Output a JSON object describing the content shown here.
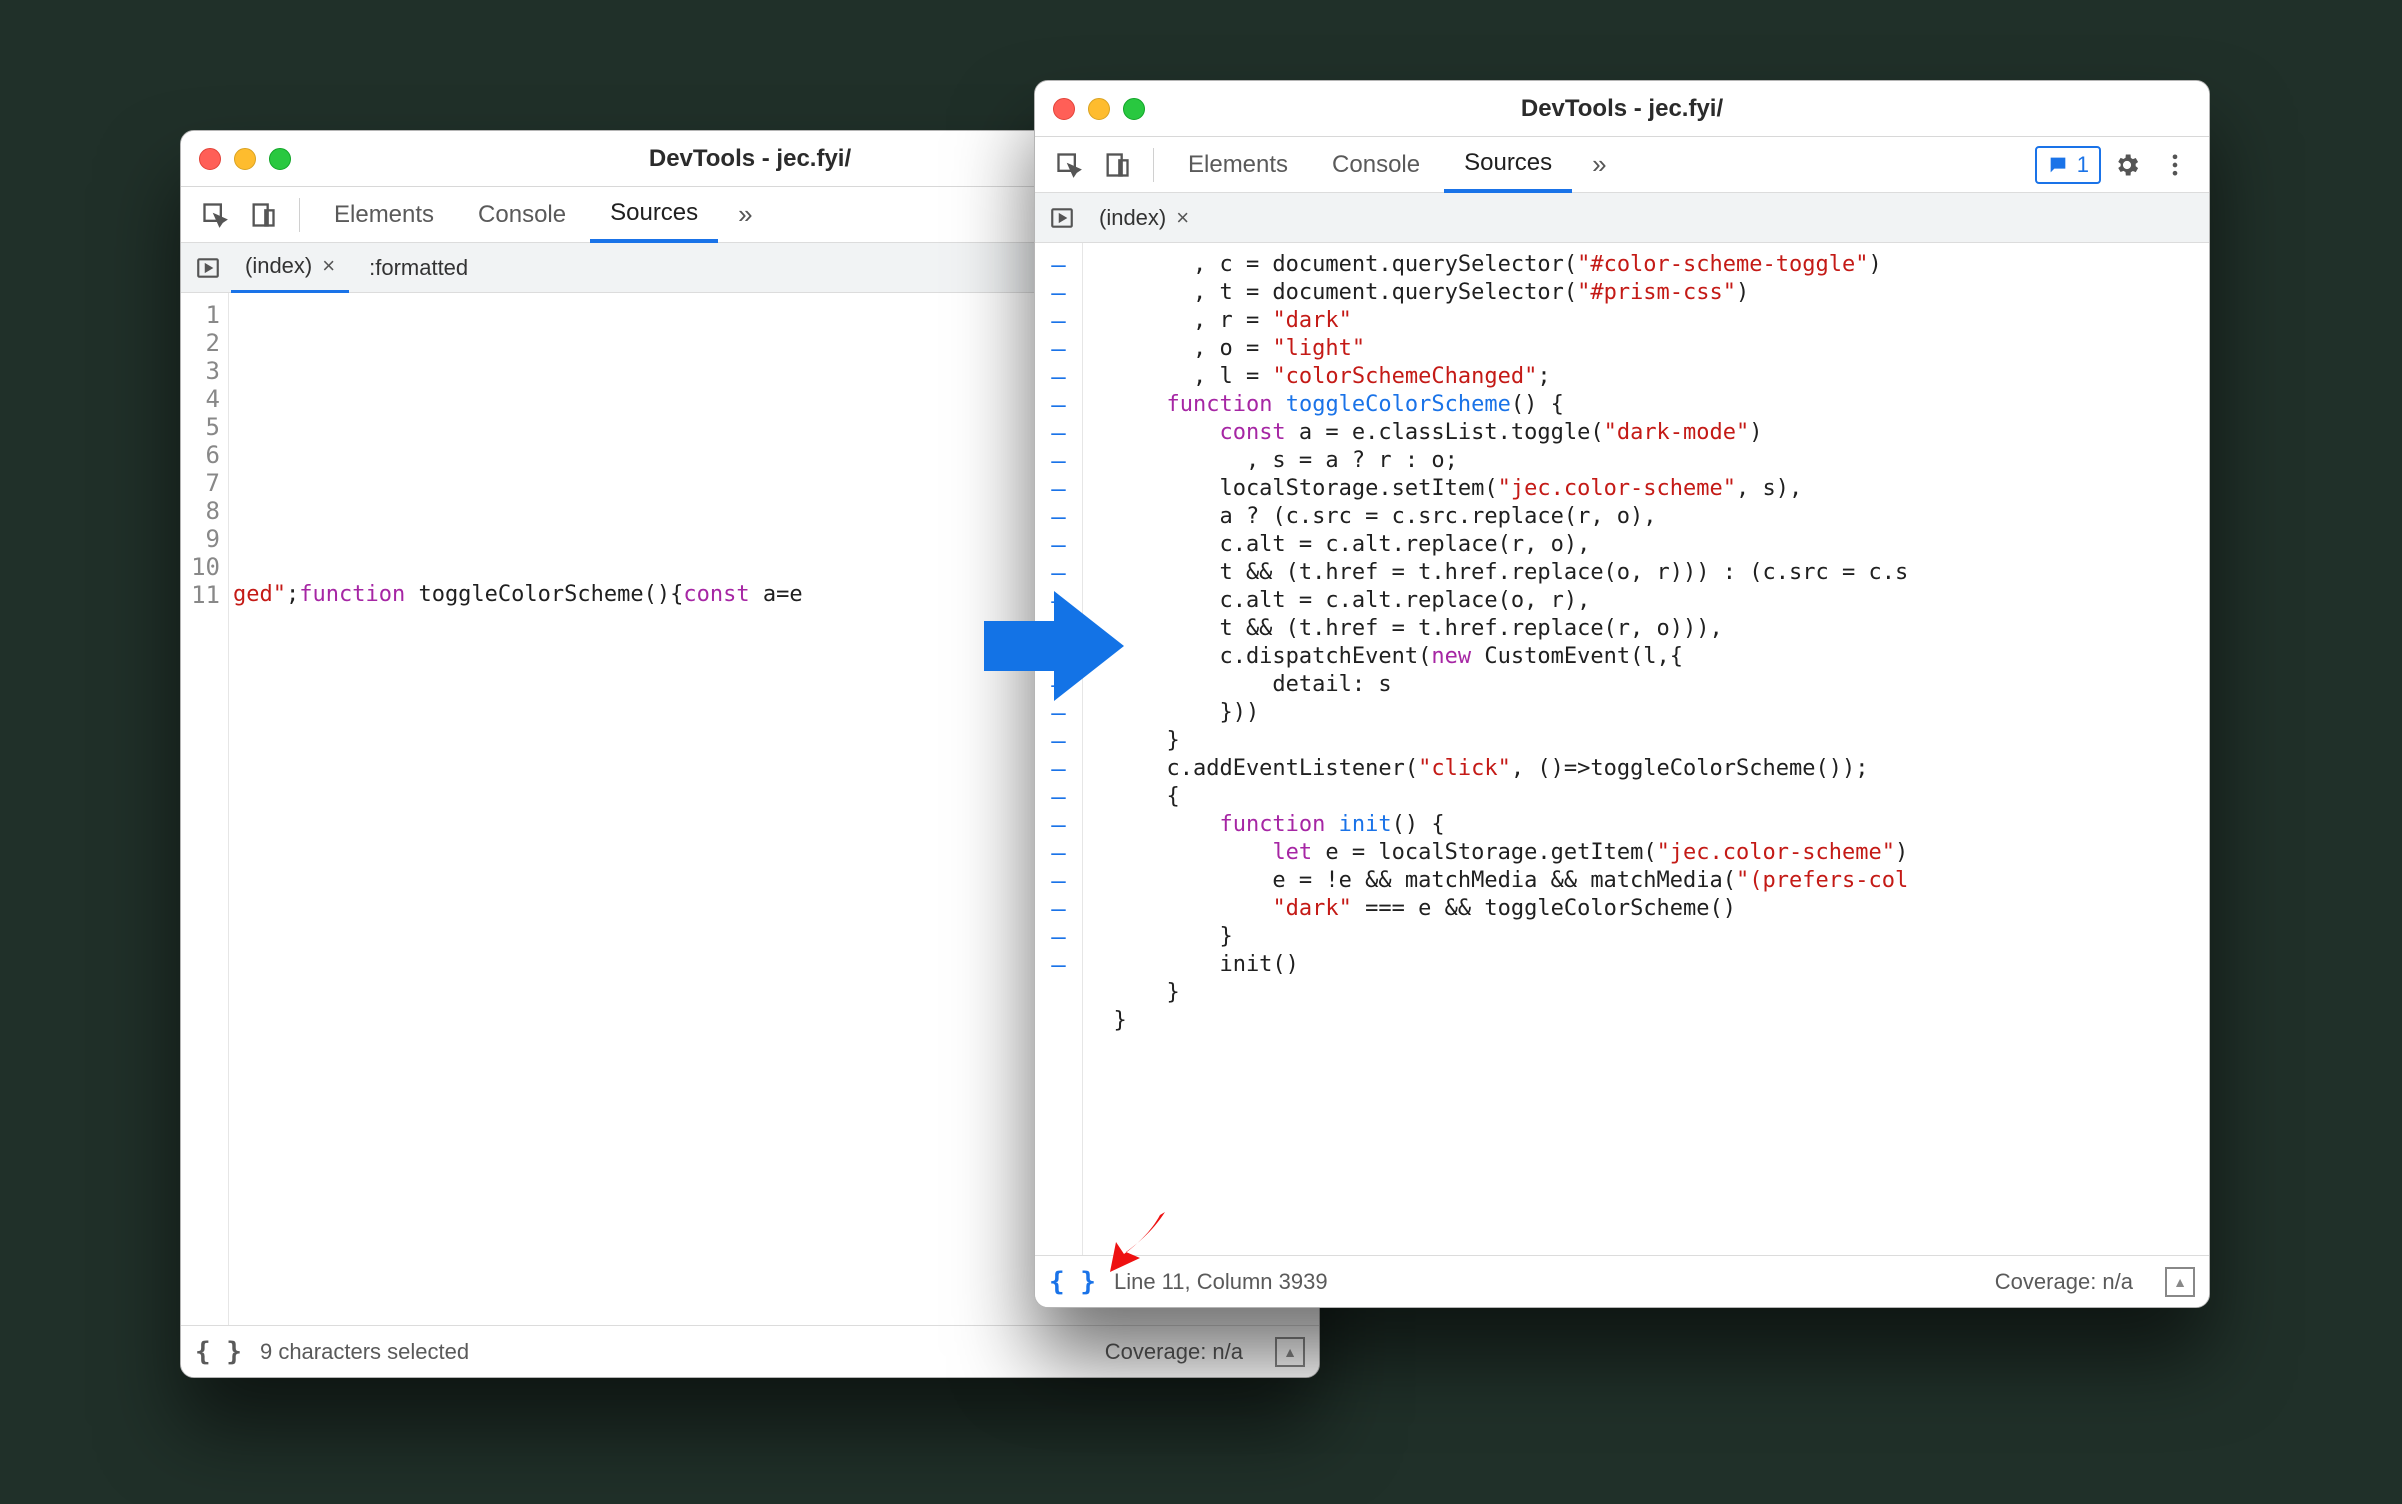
{
  "window_left": {
    "title": "DevTools - jec.fyi/",
    "tabs": {
      "elements": "Elements",
      "console": "Console",
      "sources": "Sources"
    },
    "file_tabs": {
      "index": "(index)",
      "formatted": ":formatted"
    },
    "line_numbers": [
      "1",
      "2",
      "3",
      "4",
      "5",
      "6",
      "7",
      "8",
      "9",
      "10",
      "11"
    ],
    "code_line11": {
      "seg1": "ged\"",
      "seg2": ";",
      "kw1": "function",
      "fn": " toggleColorScheme",
      "seg3": "(){",
      "kw2": "const",
      "seg4": " a=e"
    },
    "status_text": "9 characters selected",
    "coverage": "Coverage: n/a"
  },
  "window_right": {
    "title": "DevTools - jec.fyi/",
    "tabs": {
      "elements": "Elements",
      "console": "Console",
      "sources": "Sources"
    },
    "issues_count": "1",
    "file_tabs": {
      "index": "(index)"
    },
    "dash_count": 26,
    "code_lines": [
      {
        "indent": "        ",
        "tokens": [
          {
            "t": ", c = document.querySelector("
          },
          {
            "c": "str",
            "t": "\"#color-scheme-toggle\""
          },
          {
            "t": ")"
          }
        ]
      },
      {
        "indent": "        ",
        "tokens": [
          {
            "t": ", t = document.querySelector("
          },
          {
            "c": "str",
            "t": "\"#prism-css\""
          },
          {
            "t": ")"
          }
        ]
      },
      {
        "indent": "        ",
        "tokens": [
          {
            "t": ", r = "
          },
          {
            "c": "str",
            "t": "\"dark\""
          }
        ]
      },
      {
        "indent": "        ",
        "tokens": [
          {
            "t": ", o = "
          },
          {
            "c": "str",
            "t": "\"light\""
          }
        ]
      },
      {
        "indent": "        ",
        "tokens": [
          {
            "t": ", l = "
          },
          {
            "c": "str",
            "t": "\"colorSchemeChanged\""
          },
          {
            "t": ";"
          }
        ]
      },
      {
        "indent": "      ",
        "tokens": [
          {
            "c": "kw",
            "t": "function"
          },
          {
            "t": " "
          },
          {
            "c": "fn",
            "t": "toggleColorScheme"
          },
          {
            "t": "() {"
          }
        ]
      },
      {
        "indent": "          ",
        "tokens": [
          {
            "c": "kw",
            "t": "const"
          },
          {
            "t": " a = e.classList.toggle("
          },
          {
            "c": "str",
            "t": "\"dark-mode\""
          },
          {
            "t": ")"
          }
        ]
      },
      {
        "indent": "            ",
        "tokens": [
          {
            "t": ", s = a ? r : o;"
          }
        ]
      },
      {
        "indent": "          ",
        "tokens": [
          {
            "t": "localStorage.setItem("
          },
          {
            "c": "str",
            "t": "\"jec.color-scheme\""
          },
          {
            "t": ", s),"
          }
        ]
      },
      {
        "indent": "          ",
        "tokens": [
          {
            "t": "a ? (c.src = c.src.replace(r, o),"
          }
        ]
      },
      {
        "indent": "          ",
        "tokens": [
          {
            "t": "c.alt = c.alt.replace(r, o),"
          }
        ]
      },
      {
        "indent": "          ",
        "tokens": [
          {
            "t": "t && (t.href = t.href.replace(o, r))) : (c.src = c.s"
          }
        ]
      },
      {
        "indent": "          ",
        "tokens": [
          {
            "t": "c.alt = c.alt.replace(o, r),"
          }
        ]
      },
      {
        "indent": "          ",
        "tokens": [
          {
            "t": "t && (t.href = t.href.replace(r, o))),"
          }
        ]
      },
      {
        "indent": "          ",
        "tokens": [
          {
            "t": "c.dispatchEvent("
          },
          {
            "c": "new",
            "t": "new"
          },
          {
            "t": " CustomEvent(l,{"
          }
        ]
      },
      {
        "indent": "              ",
        "tokens": [
          {
            "t": "detail: s"
          }
        ]
      },
      {
        "indent": "          ",
        "tokens": [
          {
            "t": "}))"
          }
        ]
      },
      {
        "indent": "      ",
        "tokens": [
          {
            "t": "}"
          }
        ]
      },
      {
        "indent": "      ",
        "tokens": [
          {
            "t": "c.addEventListener("
          },
          {
            "c": "str",
            "t": "\"click\""
          },
          {
            "t": ", ()=>toggleColorScheme());"
          }
        ]
      },
      {
        "indent": "      ",
        "tokens": [
          {
            "t": "{"
          }
        ]
      },
      {
        "indent": "          ",
        "tokens": [
          {
            "c": "kw",
            "t": "function"
          },
          {
            "t": " "
          },
          {
            "c": "fn",
            "t": "init"
          },
          {
            "t": "() {"
          }
        ]
      },
      {
        "indent": "              ",
        "tokens": [
          {
            "c": "kw",
            "t": "let"
          },
          {
            "t": " e = localStorage.getItem("
          },
          {
            "c": "str",
            "t": "\"jec.color-scheme\""
          },
          {
            "t": ")"
          }
        ]
      },
      {
        "indent": "              ",
        "tokens": [
          {
            "t": "e = !e && matchMedia && matchMedia("
          },
          {
            "c": "str",
            "t": "\"(prefers-col"
          }
        ]
      },
      {
        "indent": "              ",
        "tokens": [
          {
            "c": "str",
            "t": "\"dark\""
          },
          {
            "t": " === e && toggleColorScheme()"
          }
        ]
      },
      {
        "indent": "          ",
        "tokens": [
          {
            "t": "}"
          }
        ]
      },
      {
        "indent": "          ",
        "tokens": [
          {
            "t": "init()"
          }
        ]
      },
      {
        "indent": "      ",
        "tokens": [
          {
            "t": "}"
          }
        ]
      },
      {
        "indent": "  ",
        "tokens": [
          {
            "t": "}"
          }
        ]
      }
    ],
    "cursor_status": "Line 11, Column 3939",
    "coverage": "Coverage: n/a"
  }
}
